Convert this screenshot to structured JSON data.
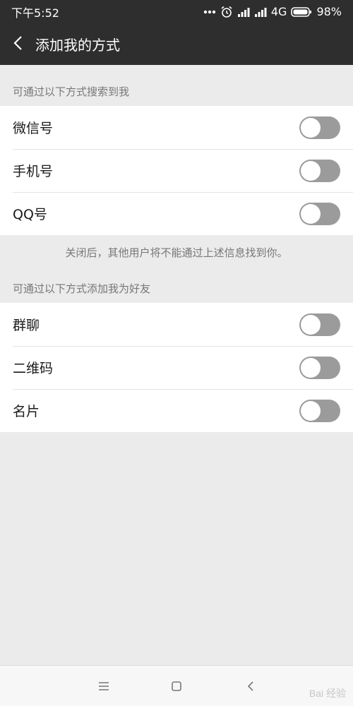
{
  "status_bar": {
    "time": "下午5:52",
    "network": "4G",
    "battery": "98%",
    "icons": [
      "more-dots-icon",
      "alarm-icon",
      "signal-icon",
      "signal-icon",
      "battery-icon"
    ]
  },
  "nav": {
    "back_icon": "chevron-left-icon",
    "title": "添加我的方式"
  },
  "search_section": {
    "header": "可通过以下方式搜索到我",
    "items": [
      {
        "label": "微信号",
        "enabled": false
      },
      {
        "label": "手机号",
        "enabled": false
      },
      {
        "label": "QQ号",
        "enabled": false
      }
    ],
    "note": "关闭后，其他用户将不能通过上述信息找到你。"
  },
  "add_section": {
    "header": "可通过以下方式添加我为好友",
    "items": [
      {
        "label": "群聊",
        "enabled": false
      },
      {
        "label": "二维码",
        "enabled": false
      },
      {
        "label": "名片",
        "enabled": false
      }
    ]
  },
  "bottom_nav": {
    "icons": [
      "menu-icon",
      "home-square-icon",
      "back-chevron-icon"
    ]
  },
  "watermark": "Bai 经验"
}
